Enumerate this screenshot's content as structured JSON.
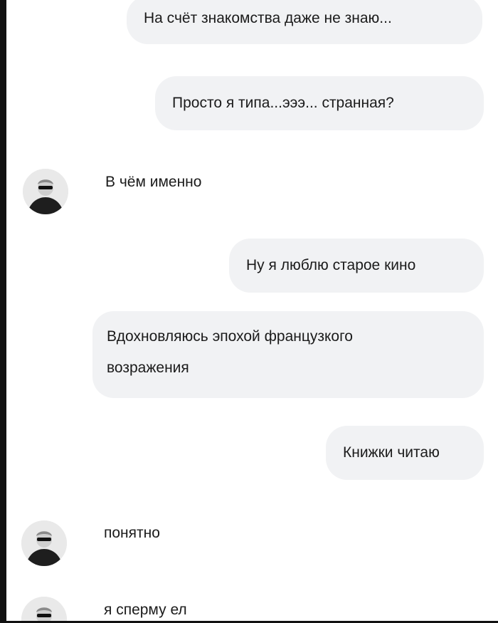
{
  "chat": {
    "messages": [
      {
        "side": "out",
        "text": "На счёт знакомства даже не знаю..."
      },
      {
        "side": "out",
        "text": "Просто я типа...эээ... странная?"
      },
      {
        "side": "in",
        "text": "В чём именно"
      },
      {
        "side": "out",
        "text": "Ну я люблю старое кино"
      },
      {
        "side": "out",
        "lines": [
          "Вдохновляюсь эпохой французкого",
          "возражения"
        ]
      },
      {
        "side": "out",
        "text": "Книжки читаю"
      },
      {
        "side": "in",
        "text": "понятно"
      },
      {
        "side": "in",
        "text": "я сперму ел"
      }
    ]
  },
  "icons": {
    "avatar": "user-avatar-icon"
  },
  "colors": {
    "bubble": "#f1f2f4",
    "text": "#1b1b1b",
    "background": "#ffffff"
  }
}
